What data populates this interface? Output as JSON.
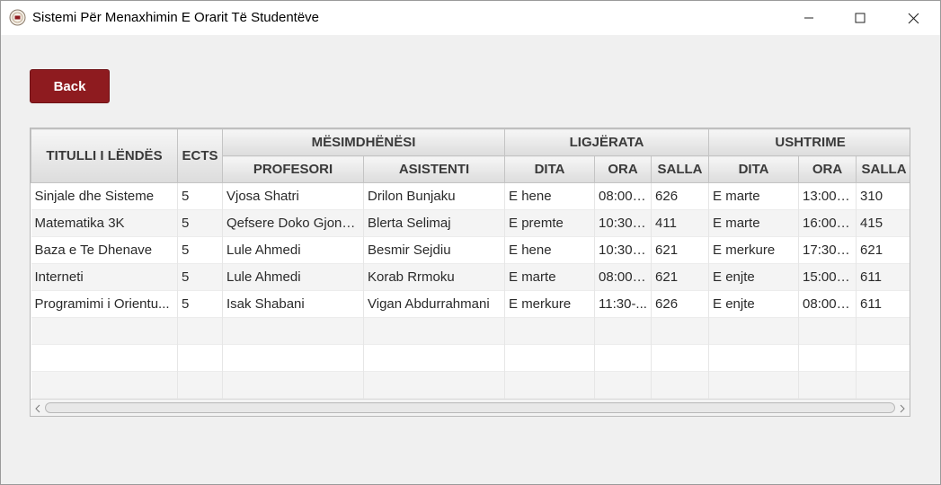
{
  "window": {
    "title": "Sistemi Për Menaxhimin E Orarit Të Studentëve",
    "icon": "university-seal-icon",
    "controls": [
      "minimize-icon",
      "maximize-icon",
      "close-icon"
    ]
  },
  "back_button": {
    "label": "Back",
    "color": "#8e1b1f"
  },
  "table": {
    "group_headers": {
      "titulli": "TITULLI I LËNDËS",
      "ects": "ECTS",
      "mesimdhenesi": "MËSIMDHËNËSI",
      "ligjerata": "LIGJËRATA",
      "ushtrime": "USHTRIME"
    },
    "sub_headers": {
      "profesori": "PROFESORI",
      "asistenti": "ASISTENTI",
      "lig_dita": "DITA",
      "lig_ora": "ORA",
      "lig_salla": "SALLA",
      "ush_dita": "DITA",
      "ush_ora": "ORA",
      "ush_salla": "SALLA"
    },
    "rows": [
      [
        "Sinjale dhe Sisteme",
        "5",
        "Vjosa Shatri",
        "Drilon Bunjaku",
        "E hene",
        "08:00-...",
        "626",
        "E marte",
        "13:00-...",
        "310"
      ],
      [
        "Matematika 3K",
        "5",
        "Qefsere Doko Gjonb...",
        "Blerta Selimaj",
        "E premte",
        "10:30-...",
        "411",
        "E marte",
        "16:00-...",
        "415"
      ],
      [
        "Baza e Te Dhenave",
        "5",
        "Lule Ahmedi",
        "Besmir Sejdiu",
        "E hene",
        "10:30-...",
        "621",
        "E merkure",
        "17:30-...",
        "621"
      ],
      [
        "Interneti",
        "5",
        "Lule Ahmedi",
        "Korab Rrmoku",
        "E marte",
        "08:00-...",
        "621",
        "E enjte",
        "15:00-...",
        "611"
      ],
      [
        "Programimi i Orientu...",
        "5",
        "Isak Shabani",
        "Vigan Abdurrahmani",
        "E merkure",
        "11:30-...",
        "626",
        "E enjte",
        "08:00-...",
        "611"
      ],
      [
        "",
        "",
        "",
        "",
        "",
        "",
        "",
        "",
        "",
        ""
      ],
      [
        "",
        "",
        "",
        "",
        "",
        "",
        "",
        "",
        "",
        ""
      ],
      [
        "",
        "",
        "",
        "",
        "",
        "",
        "",
        "",
        "",
        ""
      ]
    ]
  }
}
